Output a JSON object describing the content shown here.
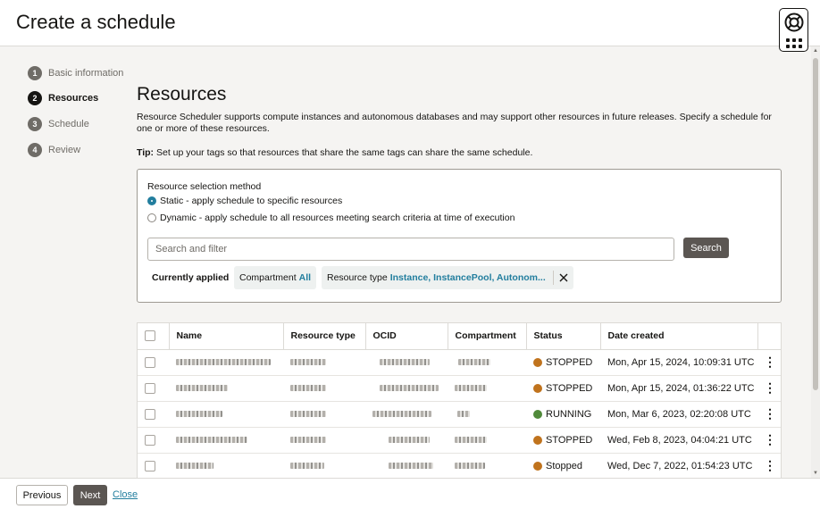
{
  "header": {
    "title": "Create a schedule"
  },
  "steps": [
    {
      "num": "1",
      "label": "Basic information"
    },
    {
      "num": "2",
      "label": "Resources"
    },
    {
      "num": "3",
      "label": "Schedule"
    },
    {
      "num": "4",
      "label": "Review"
    }
  ],
  "main": {
    "title": "Resources",
    "intro": "Resource Scheduler supports compute instances and autonomous databases and may support other resources in future releases. Specify a schedule for one or more of these resources.",
    "tip_label": "Tip:",
    "tip_text": " Set up your tags so that resources that share the same tags can share the same schedule."
  },
  "selection": {
    "label": "Resource selection method",
    "static_label": "Static - apply schedule to specific resources",
    "dynamic_label": "Dynamic - apply schedule to all resources meeting search criteria at time of execution",
    "search_placeholder": "Search and filter",
    "search_button": "Search",
    "applied_label": "Currently applied",
    "chip_compartment_key": "Compartment",
    "chip_compartment_value": "All",
    "chip_type_key": "Resource type",
    "chip_type_value": "Instance, InstancePool, Autonom..."
  },
  "table": {
    "headers": [
      "Name",
      "Resource type",
      "OCID",
      "Compartment",
      "Status",
      "Date created"
    ],
    "rows": [
      {
        "status": "STOPPED",
        "date": "Mon, Apr 15, 2024, 10:09:31 UTC",
        "status_color": "#c0731d"
      },
      {
        "status": "STOPPED",
        "date": "Mon, Apr 15, 2024, 01:36:22 UTC",
        "status_color": "#c0731d"
      },
      {
        "status": "RUNNING",
        "date": "Mon, Mar 6, 2023, 02:20:08 UTC",
        "status_color": "#508a3a"
      },
      {
        "status": "STOPPED",
        "date": "Wed, Feb 8, 2023, 04:04:21 UTC",
        "status_color": "#c0731d"
      },
      {
        "status": "Stopped",
        "date": "Wed, Dec 7, 2022, 01:54:23 UTC",
        "status_color": "#c0731d"
      }
    ]
  },
  "footer": {
    "previous": "Previous",
    "next": "Next",
    "close": "Close"
  }
}
